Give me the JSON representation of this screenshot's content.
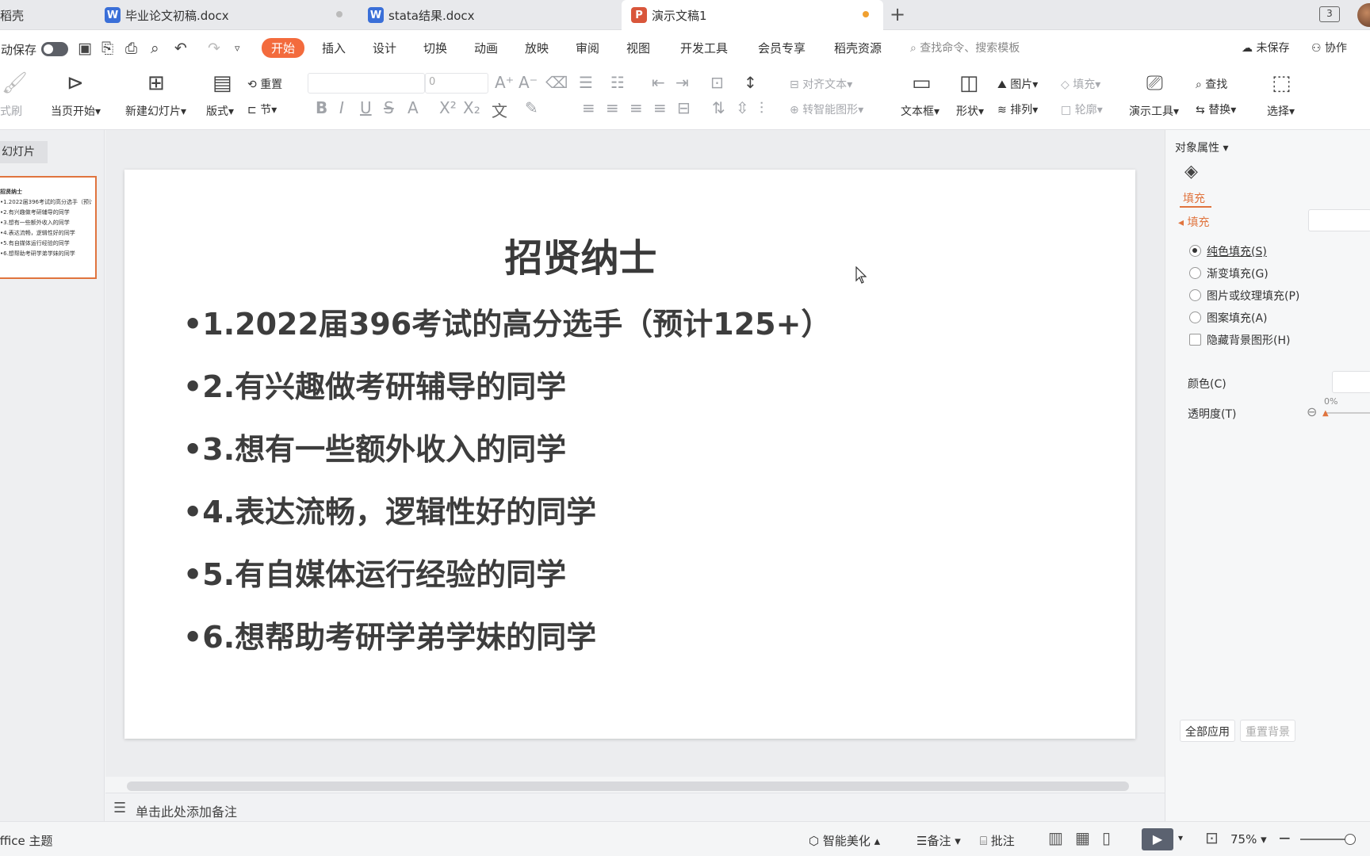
{
  "tabs": [
    {
      "label": "稻壳"
    },
    {
      "label": "毕业论文初稿.docx"
    },
    {
      "label": "stata结果.docx"
    },
    {
      "label": "演示文稿1"
    }
  ],
  "window": {
    "badge": "3"
  },
  "menubar": {
    "autosave": "自动保存",
    "items": [
      "开始",
      "插入",
      "设计",
      "切换",
      "动画",
      "放映",
      "审阅",
      "视图",
      "开发工具",
      "会员专享",
      "稻壳资源"
    ],
    "search_placeholder": "查找命令、搜索模板",
    "unsaved": "未保存",
    "collab": "协作"
  },
  "ribbon": {
    "format_brush": "格式刷",
    "play_current": "当页开始",
    "new_slide": "新建幻灯片",
    "layout": "版式",
    "reset": "重置",
    "section": "节",
    "font_size": "0",
    "align_text": "对齐文本",
    "smartart": "转智能图形",
    "textbox": "文本框",
    "shape": "形状",
    "picture": "图片",
    "arrange": "排列",
    "fill": "填充",
    "outline": "轮廓",
    "presenter_tools": "演示工具",
    "find": "查找",
    "replace": "替换",
    "select": "选择"
  },
  "leftpane": {
    "slides_tab": "幻灯片",
    "thumb_lines": [
      "招贤纳士",
      "•1.2022届396考试的高分选手（预计125+）",
      "•2.有兴趣做考研辅导的同学",
      "•3.想有一些额外收入的同学",
      "•4.表达流畅，逻辑性好的同学",
      "•5.有自媒体运行经验的同学",
      "•6.想帮助考研学弟学妹的同学"
    ]
  },
  "slide": {
    "title": "招贤纳士",
    "bullets": [
      "•1.2022届396考试的高分选手（预计125+）",
      "•2.有兴趣做考研辅导的同学",
      "•3.想有一些额外收入的同学",
      "•4.表达流畅，逻辑性好的同学",
      "•5.有自媒体运行经验的同学",
      "•6.想帮助考研学弟学妹的同学"
    ]
  },
  "notes": {
    "placeholder": "单击此处添加备注"
  },
  "rightpane": {
    "header": "对象属性",
    "fill_tab": "填充",
    "fill_section": "填充",
    "options": [
      "纯色填充(S)",
      "渐变填充(G)",
      "图片或纹理填充(P)",
      "图案填充(A)"
    ],
    "hide_bg": "隐藏背景图形(H)",
    "color": "颜色(C)",
    "transparency": "透明度(T)",
    "transparency_value": "0%",
    "apply_all": "全部应用",
    "reset_bg": "重置背景"
  },
  "statusbar": {
    "theme": "Office 主题",
    "beautify": "智能美化",
    "notes": "备注",
    "comments": "批注",
    "zoom": "75%"
  },
  "colors": {
    "accent": "#f36b3d",
    "thumb_border": "#e0743e"
  }
}
